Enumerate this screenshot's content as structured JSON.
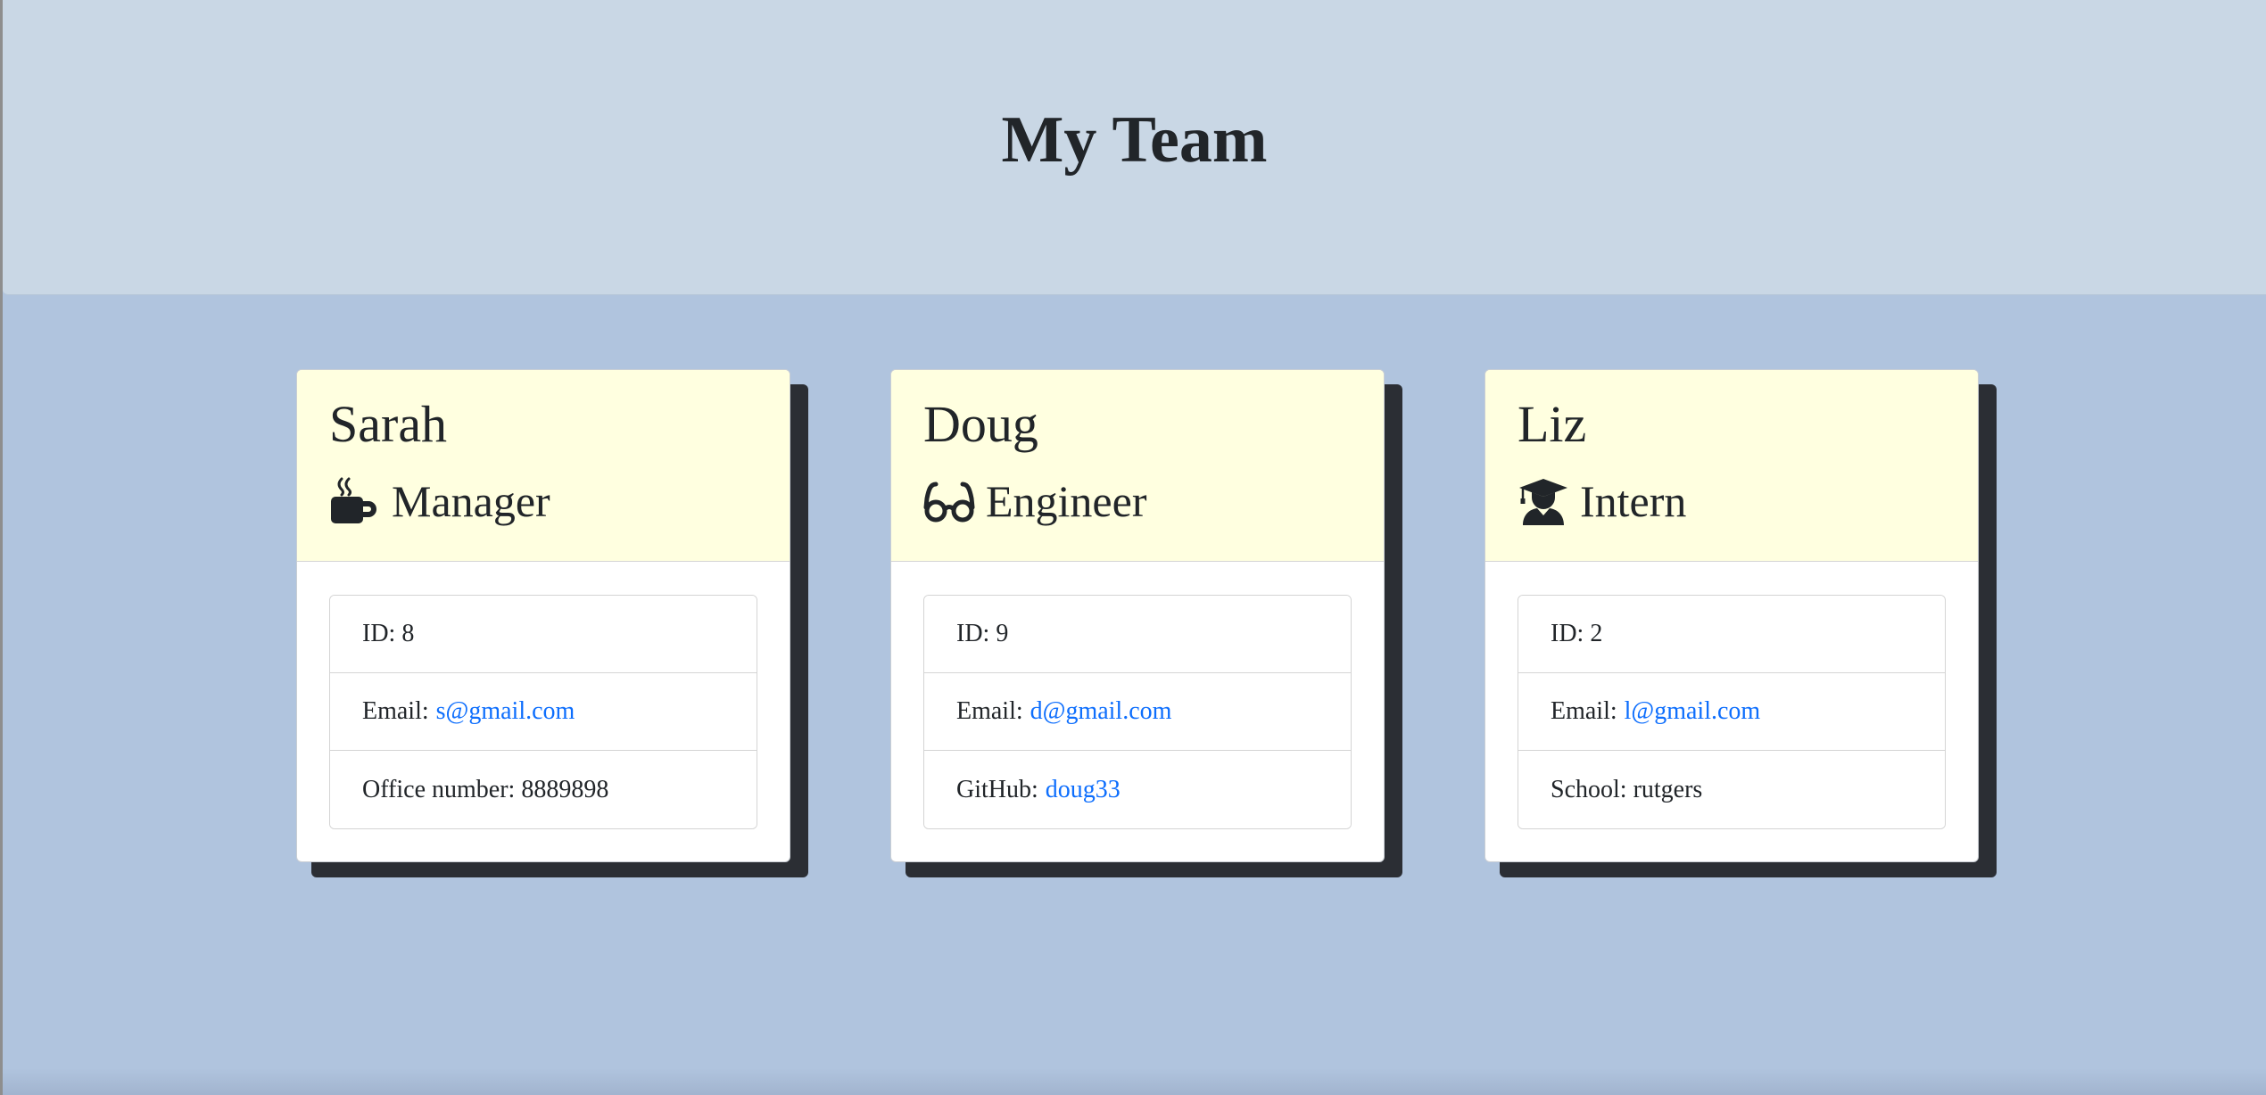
{
  "header": {
    "title": "My Team"
  },
  "colors": {
    "page_background": "#b0c4de",
    "header_background": "#c9d7e5",
    "card_header_background": "#ffffe0",
    "link": "#0d6efd",
    "shadow": "#2b2e34"
  },
  "employees": [
    {
      "name": "Sarah",
      "role": "Manager",
      "role_icon": "mug-icon",
      "id_label": "ID:",
      "id": "8",
      "email_label": "Email:",
      "email": "s@gmail.com",
      "extra_label": "Office number:",
      "extra_value": "8889898"
    },
    {
      "name": "Doug",
      "role": "Engineer",
      "role_icon": "glasses-icon",
      "id_label": "ID:",
      "id": "9",
      "email_label": "Email:",
      "email": "d@gmail.com",
      "extra_label": "GitHub:",
      "extra_value": "doug33"
    },
    {
      "name": "Liz",
      "role": "Intern",
      "role_icon": "graduate-icon",
      "id_label": "ID:",
      "id": "2",
      "email_label": "Email:",
      "email": "l@gmail.com",
      "extra_label": "School:",
      "extra_value": "rutgers"
    }
  ]
}
